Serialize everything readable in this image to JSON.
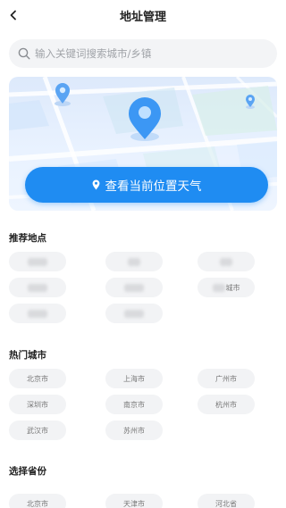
{
  "header": {
    "title": "地址管理",
    "back_icon": "chevron-left-icon"
  },
  "search": {
    "placeholder": "输入关键词搜索城市/乡镇",
    "icon": "search-icon"
  },
  "map": {
    "cta_label": "查看当前位置天气",
    "accent": "#1f8cf2"
  },
  "recommended": {
    "title": "推荐地点",
    "items": [
      "",
      "",
      "",
      "",
      "",
      "",
      "",
      ""
    ],
    "partial_suffix": "城市"
  },
  "hot_cities": {
    "title": "热门城市",
    "items": [
      "北京市",
      "上海市",
      "广州市",
      "深圳市",
      "南京市",
      "杭州市",
      "武汉市",
      "苏州市"
    ]
  },
  "provinces": {
    "title": "选择省份",
    "items": [
      "北京市",
      "天津市",
      "河北省"
    ]
  }
}
